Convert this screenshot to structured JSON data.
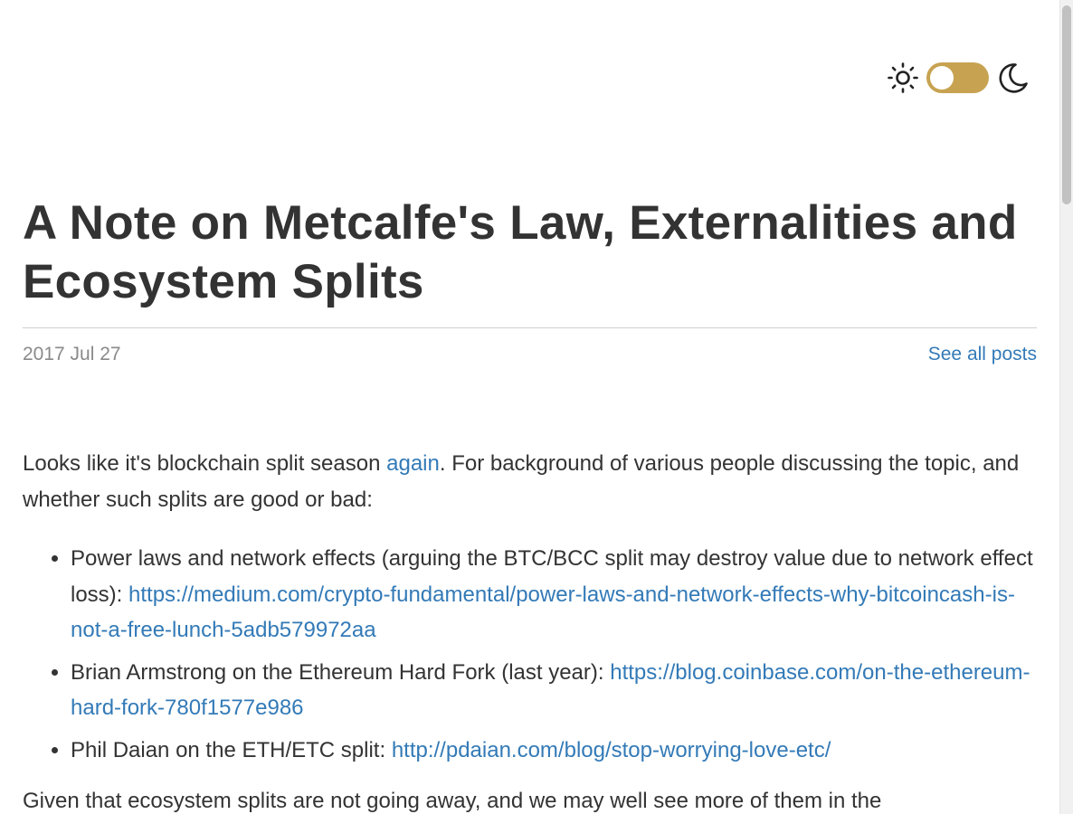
{
  "theme_toggle": {
    "light_icon": "sun-icon",
    "dark_icon": "moon-icon",
    "state": "light"
  },
  "post": {
    "title": "A Note on Metcalfe's Law, Externalities and Ecosystem Splits",
    "date": "2017 Jul 27",
    "all_posts_link": "See all posts"
  },
  "intro": {
    "before_link": "Looks like it's blockchain split season ",
    "link_text": "again",
    "after_link": ". For background of various people discussing the topic, and whether such splits are good or bad:"
  },
  "list_items": [
    {
      "text": "Power laws and network effects (arguing the BTC/BCC split may destroy value due to network effect loss): ",
      "link": "https://medium.com/crypto-fundamental/power-laws-and-network-effects-why-bitcoincash-is-not-a-free-lunch-5adb579972aa"
    },
    {
      "text": "Brian Armstrong on the Ethereum Hard Fork (last year): ",
      "link": "https://blog.coinbase.com/on-the-ethereum-hard-fork-780f1577e986"
    },
    {
      "text": "Phil Daian on the ETH/ETC split: ",
      "link": "http://pdaian.com/blog/stop-worrying-love-etc/"
    }
  ],
  "next_paragraph": "Given that ecosystem splits are not going away, and we may well see more of them in the",
  "colors": {
    "text": "#333333",
    "link": "#337ab7",
    "meta": "#8a8a8a",
    "toggle": "#c7a351"
  }
}
